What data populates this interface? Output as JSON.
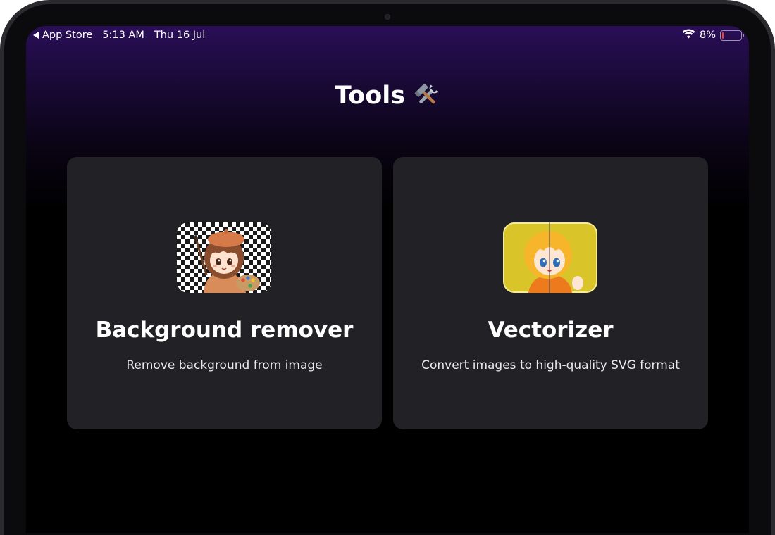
{
  "status_bar": {
    "back_app": "App Store",
    "time": "5:13 AM",
    "date": "Thu 16 Jul",
    "battery_percent": "8%",
    "battery_level": 0.08,
    "wifi_icon": "wifi-icon",
    "battery_color": "#ff3b30"
  },
  "page": {
    "title": "Tools",
    "title_icon": "hammer-and-wrench-icon"
  },
  "tools": [
    {
      "title": "Background remover",
      "description": "Remove background from image",
      "thumbnail": "anime-girl-painter-transparent-background"
    },
    {
      "title": "Vectorizer",
      "description": "Convert images to high-quality SVG format",
      "thumbnail": "anime-girl-split-raster-vector"
    }
  ],
  "colors": {
    "background_top": "#2a0e57",
    "background_bottom": "#000000",
    "card": "#222226",
    "text": "#ffffff"
  }
}
